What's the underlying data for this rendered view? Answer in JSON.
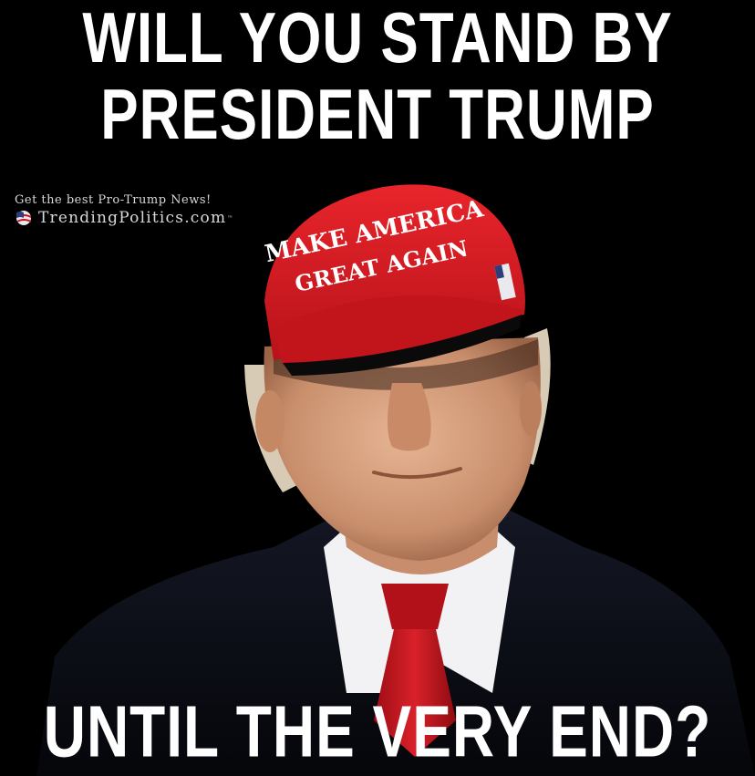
{
  "headline": {
    "line1": "WILL YOU STAND BY",
    "line2": "PRESIDENT TRUMP"
  },
  "bottom_text": "UNTIL THE VERY END?",
  "watermark": {
    "tagline": "Get the best Pro-Trump News!",
    "site": "TrendingPolitics.com",
    "trademark": "™"
  },
  "hat": {
    "line1": "MAKE AMERICA",
    "line2": "GREAT AGAIN"
  },
  "colors": {
    "background": "#000000",
    "text": "#ffffff",
    "hat_red": "#d7191f",
    "tie_red": "#c8141c",
    "suit": "#0b0d14",
    "skin": "#d9a785"
  }
}
